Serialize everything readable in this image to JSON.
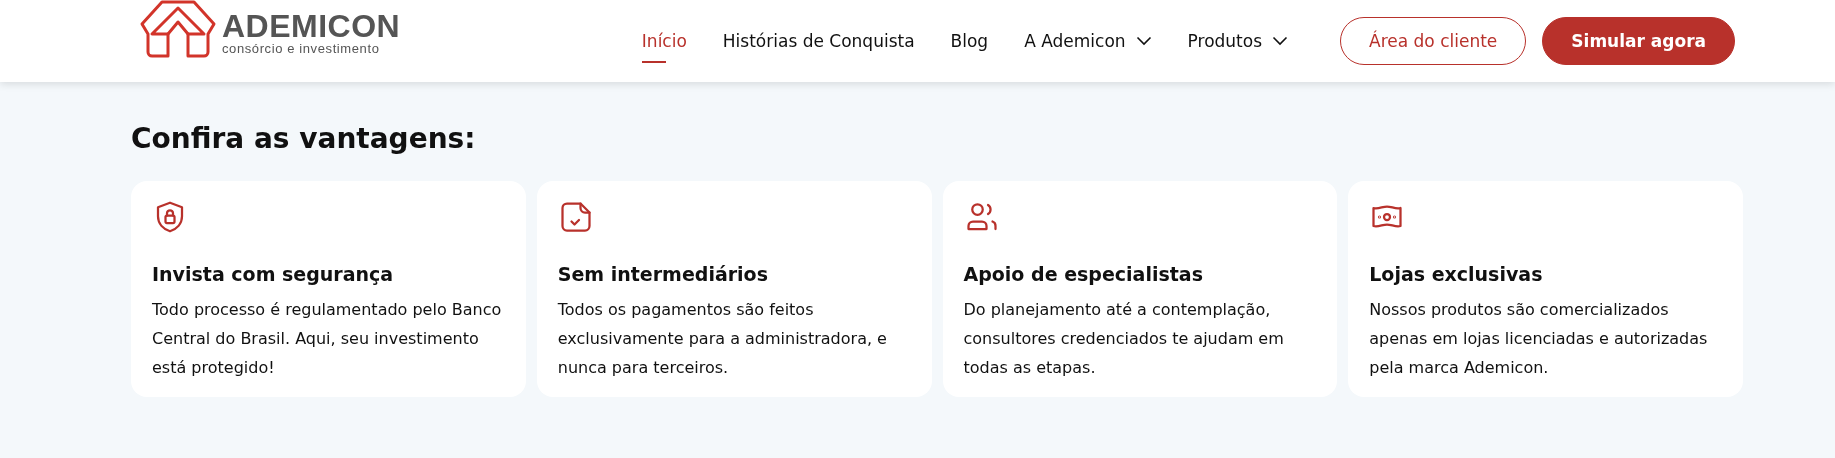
{
  "header": {
    "logo": {
      "name": "ADEMICON",
      "tagline": "consórcio e investimento"
    },
    "nav": [
      {
        "label": "Início",
        "selected": true,
        "dropdown": false
      },
      {
        "label": "Histórias de Conquista",
        "selected": false,
        "dropdown": false
      },
      {
        "label": "Blog",
        "selected": false,
        "dropdown": false
      },
      {
        "label": "A Ademicon",
        "selected": false,
        "dropdown": true
      },
      {
        "label": "Produtos",
        "selected": false,
        "dropdown": true
      }
    ],
    "buttons": [
      {
        "label": "Área do cliente",
        "kind": "outline"
      },
      {
        "label": "Simular agora",
        "kind": "solid"
      }
    ]
  },
  "section": {
    "title": "Confira as vantagens:",
    "cards": [
      {
        "kind": "shield",
        "title": "Invista com segurança",
        "text": "Todo processo é regulamentado pelo Banco Central do Brasil. Aqui, seu investimento está protegido!"
      },
      {
        "kind": "document",
        "title": "Sem intermediários",
        "text": "Todos os pagamentos são feitos exclusivamente para a administradora, e  nunca para terceiros."
      },
      {
        "kind": "people",
        "title": "Apoio de especialistas",
        "text": "Do planejamento até a contemplação, consultores credenciados te ajudam em todas as etapas."
      },
      {
        "kind": "money",
        "title": "Lojas exclusivas",
        "text": "Nossos produtos são comercializados apenas em lojas licenciadas e autorizadas pela marca Ademicon."
      }
    ]
  }
}
